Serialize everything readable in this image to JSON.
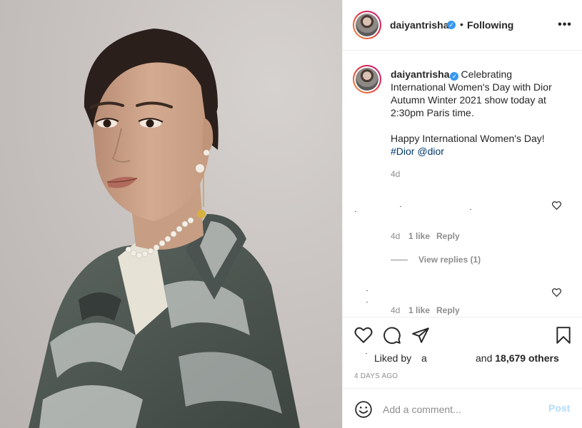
{
  "post": {
    "image_alt": "",
    "author": {
      "username": "daiyantrisha",
      "verified": true,
      "follow_separator": "•",
      "follow_status": "Following"
    },
    "more_options_label": "•••",
    "caption": {
      "username": "daiyantrisha",
      "lines": [
        "Celebrating",
        "International Women's Day with Dior",
        "Autumn Winter 2021 show today at",
        "2:30pm Paris time."
      ],
      "greeting": "Happy International Women's Day!",
      "hashtag": "#Dior",
      "mention": "@dior",
      "time": "4d"
    },
    "comments": [
      {
        "time": "4d",
        "likes": "1 like",
        "reply_label": "Reply"
      },
      {
        "time": "4d",
        "likes": "1 like",
        "reply_label": "Reply"
      }
    ],
    "view_replies_label": "View replies (1)",
    "likes": {
      "prefix": "Liked by",
      "user": "a",
      "suffix": "and",
      "count": "18,679 others"
    },
    "timestamp": "4 DAYS AGO",
    "comment_box": {
      "placeholder": "Add a comment...",
      "post_label": "Post"
    }
  },
  "icons": {
    "header_more": "more-horizontal-icon",
    "verified": "verified-badge-icon",
    "comment_heart": "heart-outline-icon",
    "like": "heart-outline-icon",
    "comment": "comment-bubble-icon",
    "share": "paper-plane-icon",
    "save": "bookmark-icon",
    "emoji": "smiley-face-icon"
  },
  "colors": {
    "verified": "#3897f0",
    "link": "#00376b",
    "muted": "#8e8e8e",
    "post_button_disabled": "#b3dbff",
    "avatar_ring_start": "#f09433",
    "avatar_ring_end": "#bc1888"
  }
}
